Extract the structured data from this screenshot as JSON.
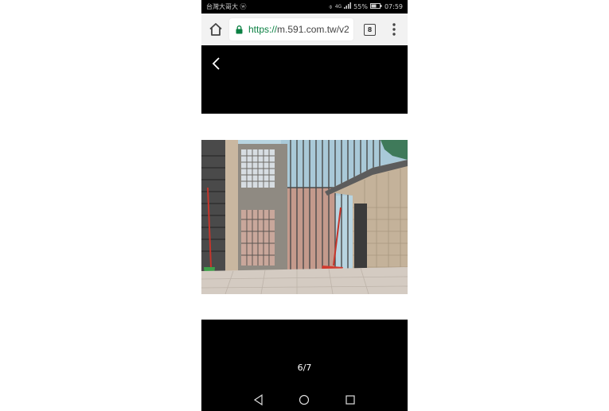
{
  "status_bar": {
    "carrier": "台灣大哥大 ⓦ",
    "network": "4G",
    "battery": "55%",
    "time": "07:59"
  },
  "browser": {
    "url_scheme": "https://",
    "url_rest": "m.591.com.tw/v2",
    "tab_count": "8",
    "home_icon": "home-icon",
    "lock_icon": "lock-icon",
    "menu_icon": "more-vert-icon"
  },
  "viewer": {
    "back_icon": "chevron-left-icon",
    "counter": "6/7"
  },
  "nav_bar": {
    "back": "triangle-back-icon",
    "home": "circle-home-icon",
    "recents": "square-recents-icon"
  }
}
